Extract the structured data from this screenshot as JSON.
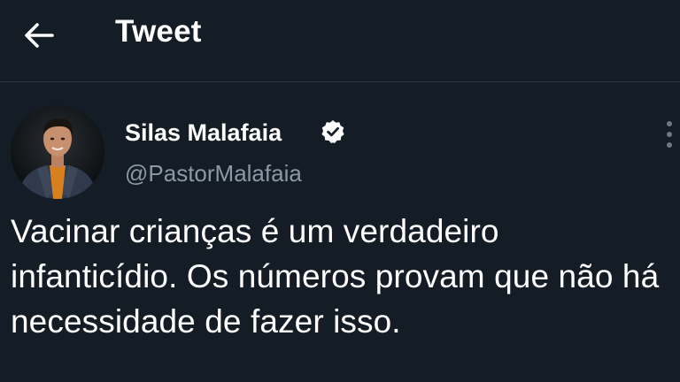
{
  "header": {
    "title": "Tweet",
    "back_icon": "arrow-left-icon"
  },
  "tweet": {
    "author": {
      "name": "Silas Malafaia",
      "handle": "@PastorMalafaia",
      "verified": true,
      "verified_icon": "verified-badge-icon"
    },
    "text": "Vacinar crianças é um verdadeiro infanticídio. Os números provam que não há necessidade de fazer isso.",
    "more_icon": "more-vertical-icon"
  },
  "colors": {
    "background": "#141d26",
    "text_primary": "#ffffff",
    "text_secondary": "#8b98a5",
    "divider": "#2a3845"
  }
}
